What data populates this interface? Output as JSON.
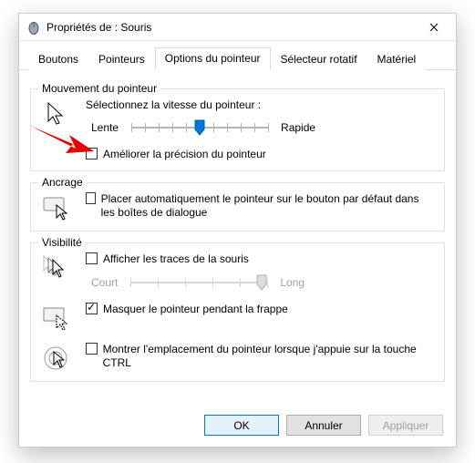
{
  "window": {
    "title": "Propriétés de : Souris"
  },
  "tabs": {
    "t0": "Boutons",
    "t1": "Pointeurs",
    "t2": "Options du pointeur",
    "t3": "Sélecteur rotatif",
    "t4": "Matériel"
  },
  "groups": {
    "motion": {
      "title": "Mouvement du pointeur",
      "prompt": "Sélectionnez la vitesse du pointeur :",
      "slow": "Lente",
      "fast": "Rapide",
      "enhance": "Améliorer la précision du pointeur"
    },
    "snap": {
      "title": "Ancrage",
      "label": "Placer automatiquement le pointeur sur le bouton par défaut dans les boîtes de dialogue"
    },
    "vis": {
      "title": "Visibilité",
      "trails": "Afficher les traces de la souris",
      "trailShort": "Court",
      "trailLong": "Long",
      "hide": "Masquer le pointeur pendant la frappe",
      "ctrl": "Montrer l'emplacement du pointeur lorsque j'appuie sur la touche CTRL"
    }
  },
  "buttons": {
    "ok": "OK",
    "cancel": "Annuler",
    "apply": "Appliquer"
  }
}
